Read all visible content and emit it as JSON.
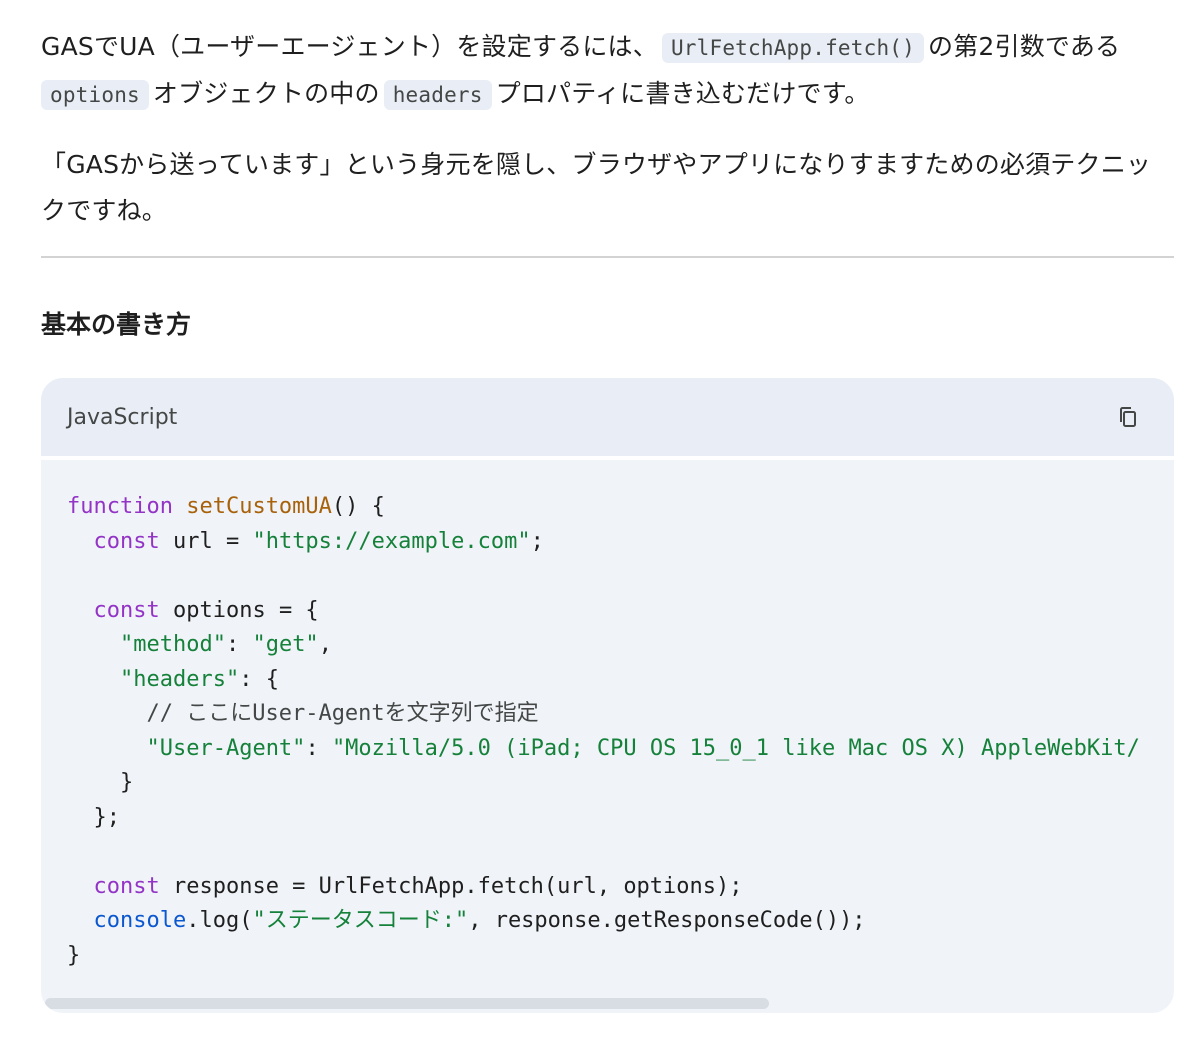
{
  "intro": {
    "p1_a": "GASでUA（ユーザーエージェント）を設定するには、",
    "p1_code1": "UrlFetchApp.fetch()",
    "p1_b": "の第2引数である",
    "p1_code2": "options",
    "p1_c": "オブジェクトの中の",
    "p1_code3": "headers",
    "p1_d": "プロパティに書き込むだけです。",
    "p2": "「GASから送っています」という身元を隠し、ブラウザやアプリになりすますための必須テクニックですね。"
  },
  "section": {
    "title": "基本の書き方"
  },
  "code_block": {
    "language": "JavaScript",
    "copy_icon": "copy-icon",
    "tokens": {
      "l1_kw": "function",
      "l1_fn": "setCustomUA",
      "l1_rest": "() {",
      "l2_kw": "const",
      "l2_plain": " url = ",
      "l2_str": "\"https://example.com\"",
      "l2_end": ";",
      "l4_kw": "const",
      "l4_plain": " options = {",
      "l5_str1": "\"method\"",
      "l5_mid": ": ",
      "l5_str2": "\"get\"",
      "l5_end": ",",
      "l6_str": "\"headers\"",
      "l6_end": ": {",
      "l7_cmt": "// ここにUser-Agentを文字列で指定",
      "l8_str1": "\"User-Agent\"",
      "l8_mid": ": ",
      "l8_str2": "\"Mozilla/5.0 (iPad; CPU OS 15_0_1 like Mac OS X) AppleWebKit/",
      "l9": "}",
      "l10": "};",
      "l12_kw": "const",
      "l12_plain": " response = UrlFetchApp.fetch(url, options);",
      "l13_obj": "console",
      "l13_a": ".log(",
      "l13_str": "\"ステータスコード:\"",
      "l13_b": ", response.getResponseCode());",
      "l14": "}"
    }
  }
}
